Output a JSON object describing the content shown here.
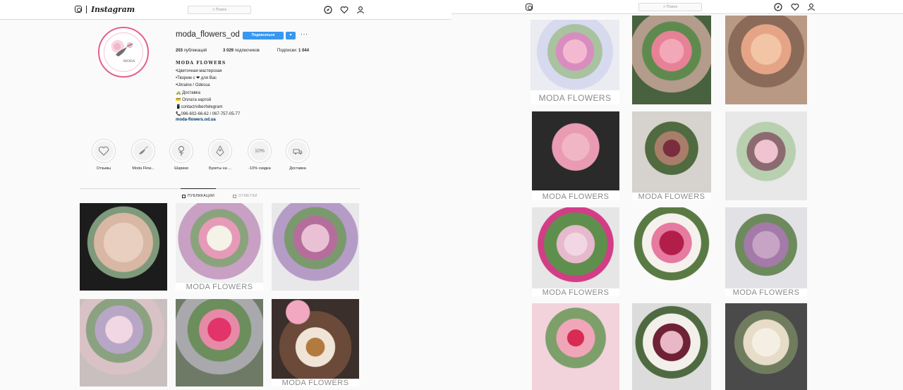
{
  "brand": {
    "wordmark": "Instagram"
  },
  "search": {
    "placeholder": "⌕ Поиск"
  },
  "profile": {
    "username": "moda_flowers_od",
    "follow_label": "Подписаться",
    "dropdown_glyph": "▾",
    "more_glyph": "···",
    "posts_count": "203",
    "posts_label": "публикаций",
    "followers_count": "3 029",
    "followers_label": "подписчиков",
    "following_label": "Подписки:",
    "following_count": "1 044",
    "bio_name": "MODA FLOWERS",
    "bio_lines": [
      "•Цветочная мастерская",
      "•Творим с ❤ для Вас",
      "•Ukraine / Odessa",
      "🚕 Доставка",
      "💳 Оплата картой",
      "📱contact/viber/telegram",
      "📞096-602-66-62 / 067-757-05-77"
    ],
    "website": "moda-flowers.od.ua",
    "avatar_text": "MODA"
  },
  "highlights": [
    {
      "label": "Отзывы",
      "icon": "heart-icon"
    },
    {
      "label": "Moda Flow...",
      "icon": "bird-icon"
    },
    {
      "label": "Шарики",
      "icon": "rose-icon"
    },
    {
      "label": "Букеты на ...",
      "icon": "bouquet-icon"
    },
    {
      "label": "-10% скидка",
      "icon": "discount-icon",
      "text": "10%"
    },
    {
      "label": "Доставка",
      "icon": "delivery-icon"
    }
  ],
  "tabs": [
    {
      "label": "ПУБЛИКАЦИИ",
      "active": true
    },
    {
      "label": "ОТМЕТКИ",
      "active": false
    }
  ],
  "watermark": "MODA FLOWERS",
  "colors": {
    "accent": "#3897f0",
    "ring": "#e5608a",
    "link": "#003569"
  }
}
